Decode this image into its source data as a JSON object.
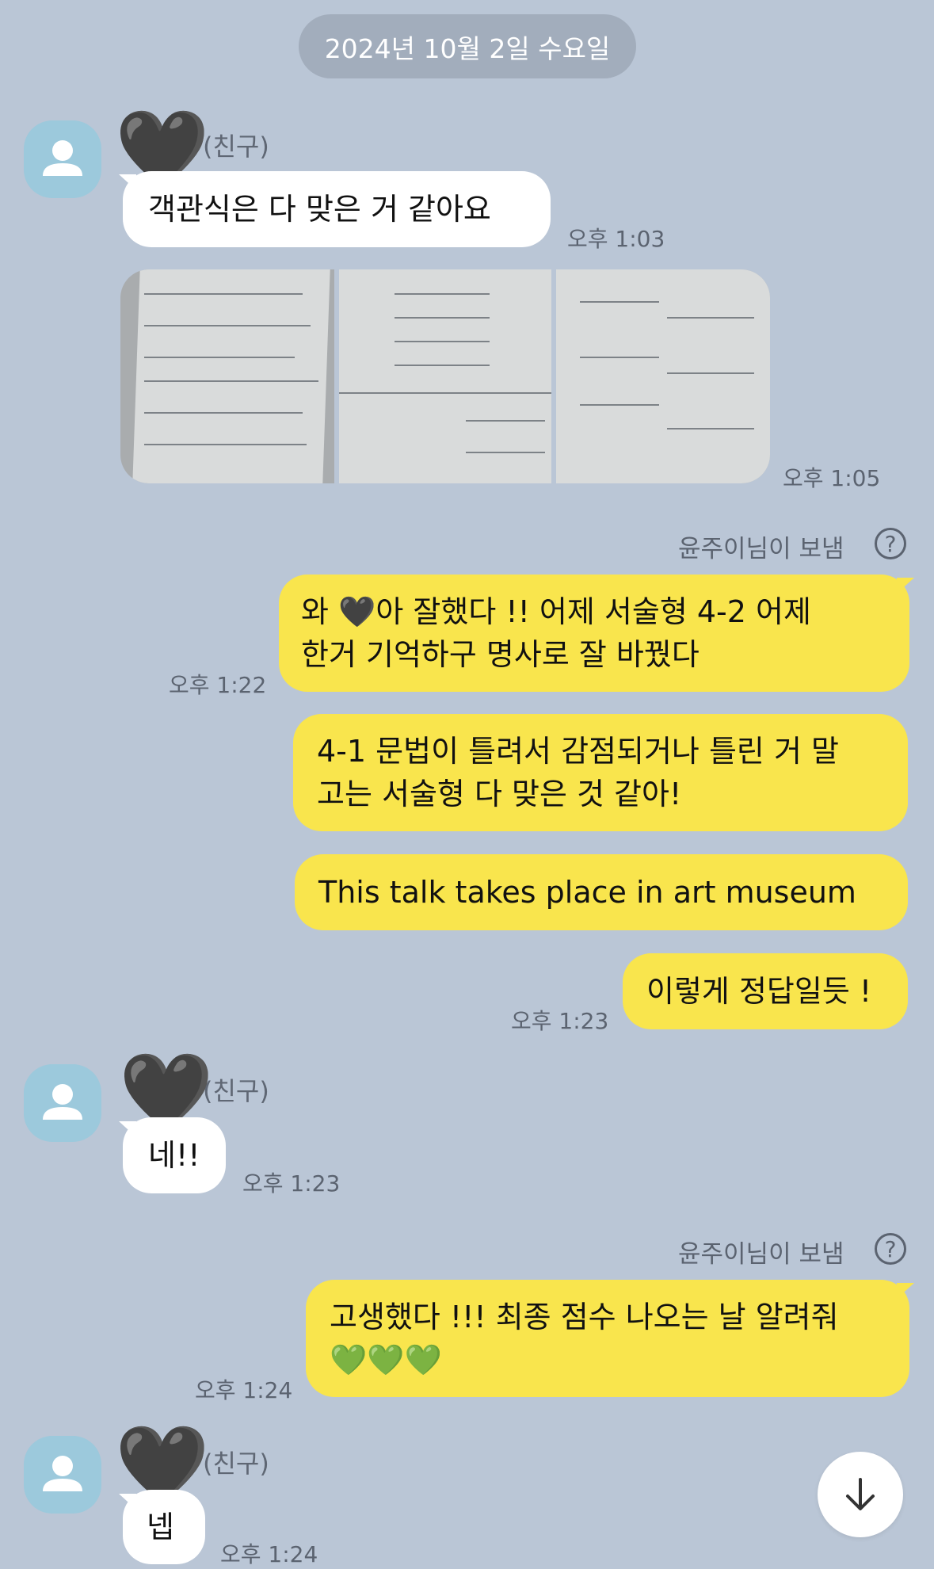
{
  "date_divider": "2024년 10월 2일 수요일",
  "friend_name": "(친구)",
  "sender_note": "윤주이님이 보냄",
  "help_symbol": "?",
  "heart_emoji": "🖤",
  "messages": {
    "m1": {
      "text": "객관식은 다 맞은 거 같아요",
      "time": "오후 1:03"
    },
    "photos": {
      "time": "오후 1:05"
    },
    "m2": {
      "line1": "와 🖤아 잘했다 !! 어제 서술형 4-2 어제",
      "line2": "한거 기억하구 명사로 잘 바꿨다",
      "time": "오후 1:22"
    },
    "m3": {
      "line1": "4-1 문법이 틀려서 감점되거나 틀린 거 말",
      "line2": "고는 서술형 다 맞은 것 같아!"
    },
    "m4": {
      "text": "This talk takes place in art museum"
    },
    "m5": {
      "text": "이렇게 정답일듯 !",
      "time": "오후 1:23"
    },
    "m6": {
      "text": "네!!",
      "time": "오후 1:23"
    },
    "m7": {
      "line1": "고생했다 !!! 최종 점수 나오는 날 알려줘",
      "line2": "💚💚💚",
      "time": "오후 1:24"
    },
    "m8": {
      "text": "넵",
      "time": "오후 1:24"
    }
  },
  "icons": {
    "avatar": "person-silhouette-icon",
    "scroll_down": "arrow-down-icon",
    "help": "question-circle-icon"
  },
  "colors": {
    "background": "#bac6d6",
    "outgoing_bubble": "#f9e54d",
    "incoming_bubble": "#ffffff",
    "avatar": "#9cc9dc"
  }
}
